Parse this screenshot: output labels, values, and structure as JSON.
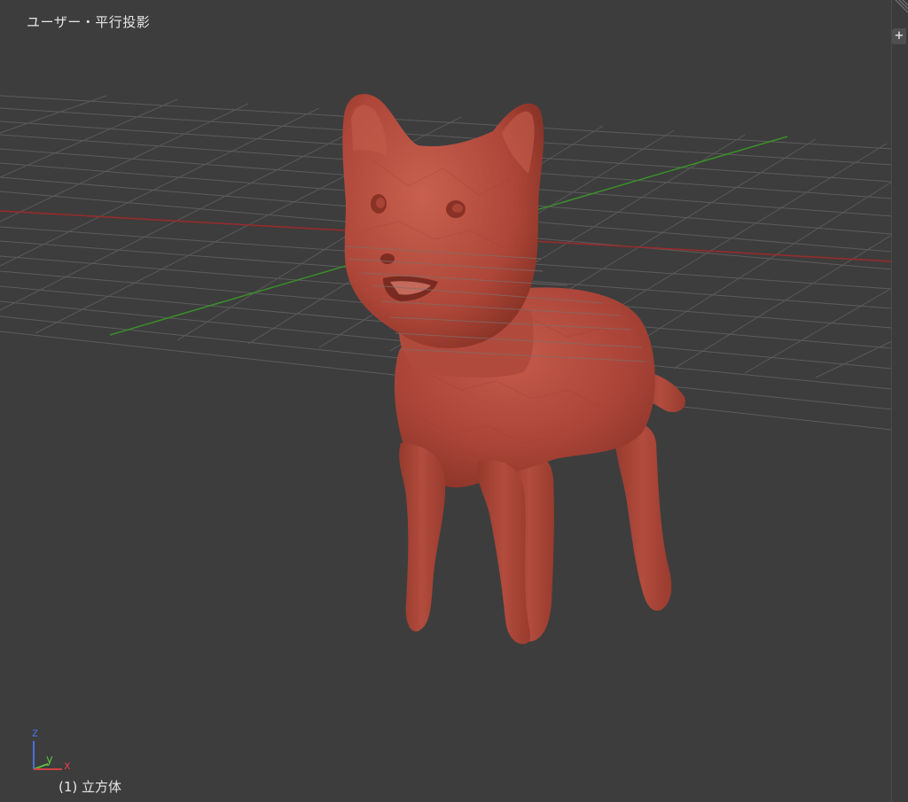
{
  "viewport": {
    "title": "ユーザー・平行投影",
    "object_label": "(1) 立方体",
    "background_color": "#3d3d3d",
    "grid_color": "#5a5a5a",
    "x_axis_color": "#9c2a2a",
    "y_axis_color": "#3a8f2a",
    "model_color": "#b04a3c",
    "model_name": "cat-sculpt-mesh"
  },
  "gizmo": {
    "z_label": "z",
    "y_label": "y",
    "x_label": "x",
    "z_color": "#4a6fd8",
    "y_color": "#5fc040",
    "x_color": "#d04040"
  },
  "toolshelf": {
    "toggle_icon": "plus-icon",
    "toggle_label": "+"
  }
}
